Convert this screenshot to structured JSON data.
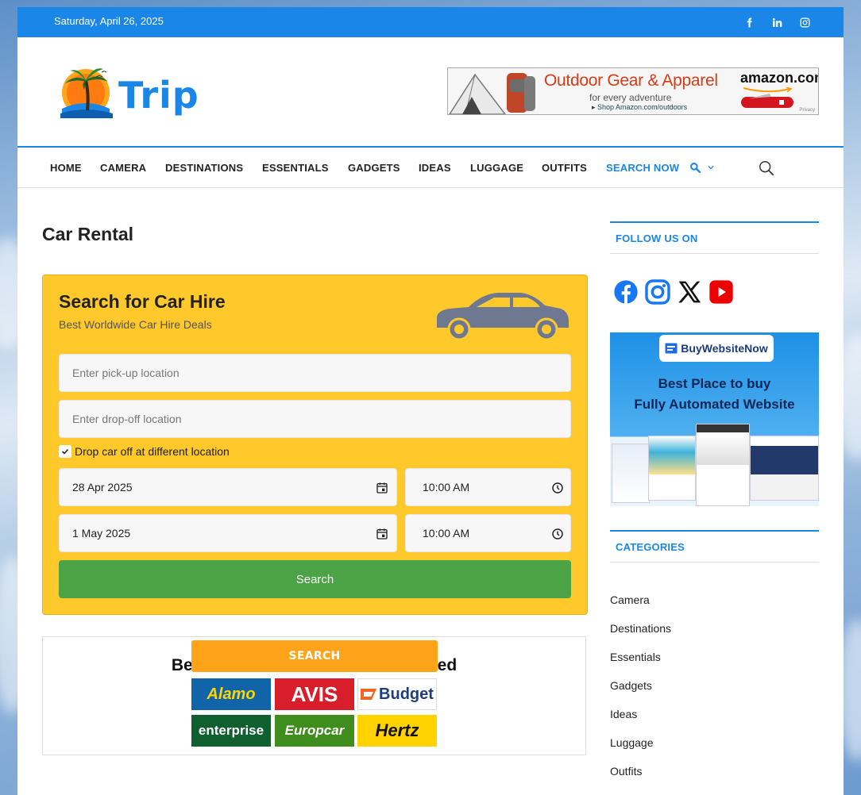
{
  "topbar": {
    "date": "Saturday, April 26, 2025",
    "social_icons": [
      "facebook-icon",
      "linkedin-icon",
      "instagram-icon"
    ],
    "color": "#1a86e8"
  },
  "header": {
    "logo_text": "Trip",
    "ad": {
      "headline": "Outdoor Gear & Apparel",
      "sub": "for every adventure",
      "link": "▸ Shop Amazon.com/outdoors",
      "brand": "amazon.com",
      "privacy": "Privacy"
    }
  },
  "nav": {
    "items": [
      {
        "label": "HOME"
      },
      {
        "label": "CAMERA"
      },
      {
        "label": "DESTINATIONS"
      },
      {
        "label": "ESSENTIALS"
      },
      {
        "label": "GADGETS"
      },
      {
        "label": "IDEAS"
      },
      {
        "label": "LUGGAGE"
      },
      {
        "label": "OUTFITS"
      },
      {
        "label": "SEARCH NOW"
      }
    ]
  },
  "main": {
    "page_title": "Car Rental",
    "widget": {
      "title": "Search for Car Hire",
      "subtitle": "Best Worldwide Car Hire Deals",
      "pickup_placeholder": "Enter pick-up location",
      "dropoff_placeholder": "Enter drop-off location",
      "different_location_label": "Drop car off at different location",
      "different_location_checked": true,
      "pickup_date": "28 Apr 2025",
      "pickup_time": "10:00 AM",
      "dropoff_date": "1 May 2025",
      "dropoff_time": "10:00 AM",
      "search_label": "Search",
      "accent": "#ffc82b",
      "button_color": "#4ca345"
    },
    "promo": {
      "heading": "Be",
      "heading_end": "ed",
      "search_label": "SEARCH",
      "brands": [
        "Alamo",
        "AVIS",
        "Budget",
        "enterprise",
        "Europcar",
        "Hertz"
      ]
    }
  },
  "sidebar": {
    "follow_heading": "FOLLOW US ON",
    "follow_icons": [
      "facebook-icon",
      "instagram-icon",
      "x-icon",
      "youtube-icon"
    ],
    "ad": {
      "logo": "BuyWebsiteNow",
      "line1": "Best Place to buy",
      "line2": "Fully Automated Website"
    },
    "categories_heading": "CATEGORIES",
    "categories": [
      "Camera",
      "Destinations",
      "Essentials",
      "Gadgets",
      "Ideas",
      "Luggage",
      "Outfits"
    ]
  }
}
